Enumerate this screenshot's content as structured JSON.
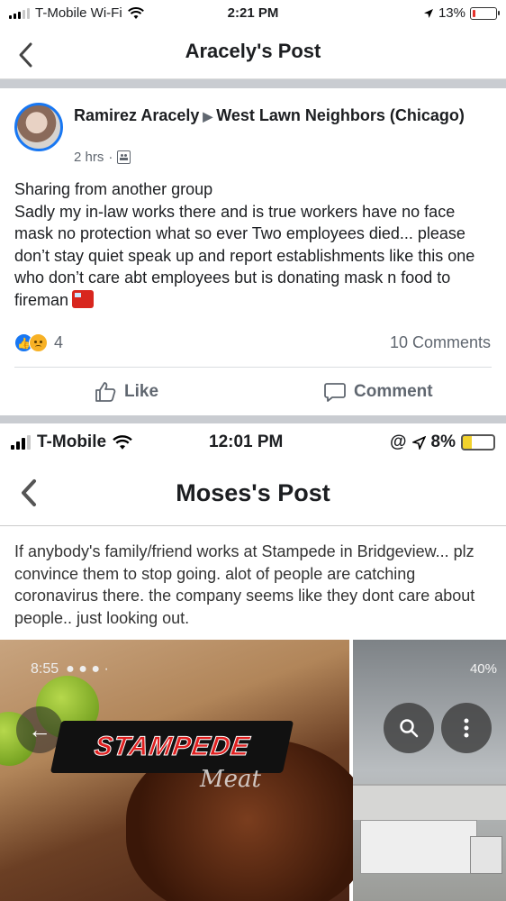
{
  "status_bar": {
    "carrier": "T-Mobile Wi-Fi",
    "time": "2:21 PM",
    "battery": "13%",
    "battery_level": 0.13
  },
  "nav": {
    "back_icon": "chevron-left-icon",
    "title": "Aracely's Post"
  },
  "post": {
    "author": "Ramirez Aracely",
    "group": "West Lawn Neighbors (Chicago)",
    "time": "2 hrs",
    "lines": [
      "Sharing from another group",
      "Sadly my in-law works there and is true workers have no face mask no protection what so ever Two employees died... please don’t stay quiet speak up and report establishments like this one who don’t care abt employees but is donating mask n food to fireman"
    ],
    "reaction_count": "4",
    "comments": "10 Comments",
    "like_label": "Like",
    "comment_label": "Comment"
  },
  "shared_screenshot": {
    "status": {
      "carrier": "T-Mobile",
      "time": "12:01 PM",
      "battery": "8%"
    },
    "title": "Moses's Post",
    "text": "If anybody's family/friend works at Stampede in Bridgeview... plz convince them to stop going. alot of people are catching coronavirus there. the company seems like they dont care about people.. just looking out.",
    "image_left": {
      "status_time": "8:55",
      "logo_text": "STAMPEDE",
      "logo_sub": "Meat"
    },
    "image_right": {
      "status_battery": "40%"
    }
  },
  "colors": {
    "accent": "#1877f2",
    "divider": "#c9ccd1",
    "muted": "#606770"
  }
}
